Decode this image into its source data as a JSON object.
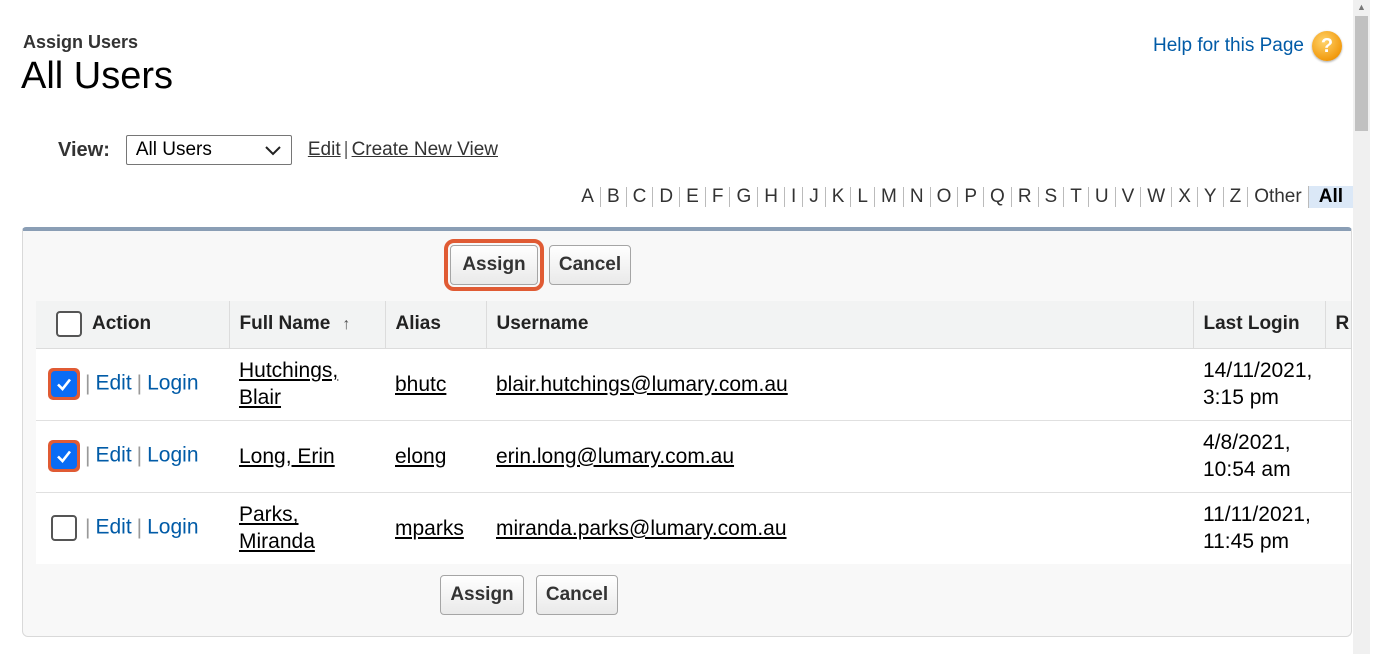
{
  "header": {
    "subtitle": "Assign Users",
    "title": "All Users",
    "help_link": "Help for this Page",
    "help_icon": "?"
  },
  "view": {
    "label": "View:",
    "selected": "All Users",
    "edit_link": "Edit",
    "separator": "|",
    "create_link": "Create New View"
  },
  "alphabet": [
    "A",
    "B",
    "C",
    "D",
    "E",
    "F",
    "G",
    "H",
    "I",
    "J",
    "K",
    "L",
    "M",
    "N",
    "O",
    "P",
    "Q",
    "R",
    "S",
    "T",
    "U",
    "V",
    "W",
    "X",
    "Y",
    "Z",
    "Other",
    "All"
  ],
  "alphabet_active": "All",
  "buttons": {
    "assign": "Assign",
    "cancel": "Cancel"
  },
  "table": {
    "columns": [
      "Action",
      "Full Name",
      "Alias",
      "Username",
      "Last Login",
      "R"
    ],
    "sort_icon": "↑",
    "rows": [
      {
        "checked": true,
        "edit": "Edit",
        "login": "Login",
        "name_line1": "Hutchings,",
        "name_line2": "Blair",
        "alias": "bhutc",
        "username": "blair.hutchings@lumary.com.au",
        "last_login_line1": "14/11/2021,",
        "last_login_line2": "3:15 pm"
      },
      {
        "checked": true,
        "edit": "Edit",
        "login": "Login",
        "name_line1": "Long, Erin",
        "name_line2": "",
        "alias": "elong",
        "username": "erin.long@lumary.com.au",
        "last_login_line1": "4/8/2021,",
        "last_login_line2": "10:54 am"
      },
      {
        "checked": false,
        "edit": "Edit",
        "login": "Login",
        "name_line1": "Parks,",
        "name_line2": "Miranda",
        "alias": "mparks",
        "username": "miranda.parks@lumary.com.au",
        "last_login_line1": "11/11/2021,",
        "last_login_line2": "11:45 pm"
      }
    ]
  },
  "colors": {
    "highlight": "#e05b34",
    "link": "#015ba7",
    "checkbox": "#0a6cf5"
  }
}
